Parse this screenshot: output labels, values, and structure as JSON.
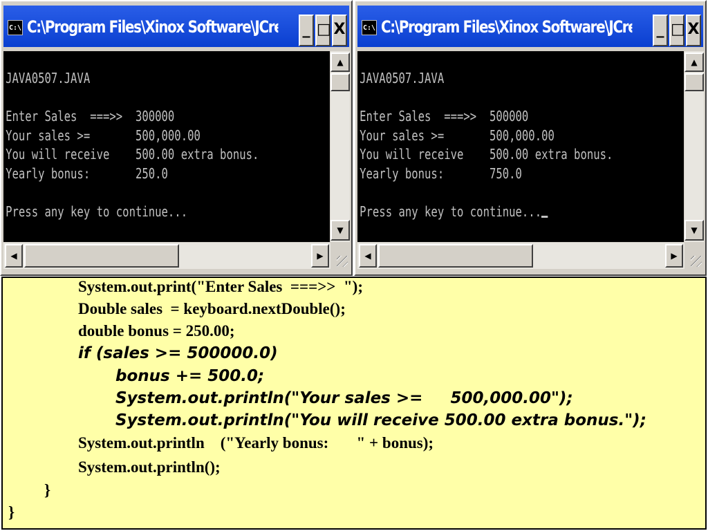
{
  "windows": [
    {
      "title": "C:\\Program Files\\Xinox Software\\JCreator...",
      "console": {
        "header": "JAVA0507.JAVA",
        "lines": [
          "Enter Sales  ===>>  300000",
          "Your sales >=       500,000.00",
          "You will receive    500.00 extra bonus.",
          "Yearly bonus:       250.0"
        ],
        "prompt": "Press any key to continue..."
      }
    },
    {
      "title": "C:\\Program Files\\Xinox Software\\JCreator...",
      "console": {
        "header": "JAVA0507.JAVA",
        "lines": [
          "Enter Sales  ===>>  500000",
          "Your sales >=       500,000.00",
          "You will receive    500.00 extra bonus.",
          "Yearly bonus:       750.0"
        ],
        "prompt": "Press any key to continue..."
      }
    }
  ],
  "window_controls": {
    "icon": "C:\\",
    "minimize": "_",
    "maximize": "□",
    "close": "X",
    "up": "▲",
    "down": "▼",
    "left": "◀",
    "right": "▶"
  },
  "code": [
    "System.out.print(\"Enter Sales  ===>>  \");",
    "Double sales  = keyboard.nextDouble();",
    "double bonus = 250.00;",
    "if (sales >= 500000.0)",
    "bonus += 500.0;",
    "System.out.println(\"Your sales >=     500,000.00\");",
    "System.out.println(\"You will receive 500.00 extra bonus.\");",
    "System.out.println    (\"Yearly bonus:       \" + bonus);",
    "System.out.println();",
    "}",
    "}"
  ],
  "colors": {
    "titlebar": "#0a3fd0",
    "code_background": "#ffffa8",
    "console_background": "#000000",
    "console_text": "#c0c0c0"
  }
}
